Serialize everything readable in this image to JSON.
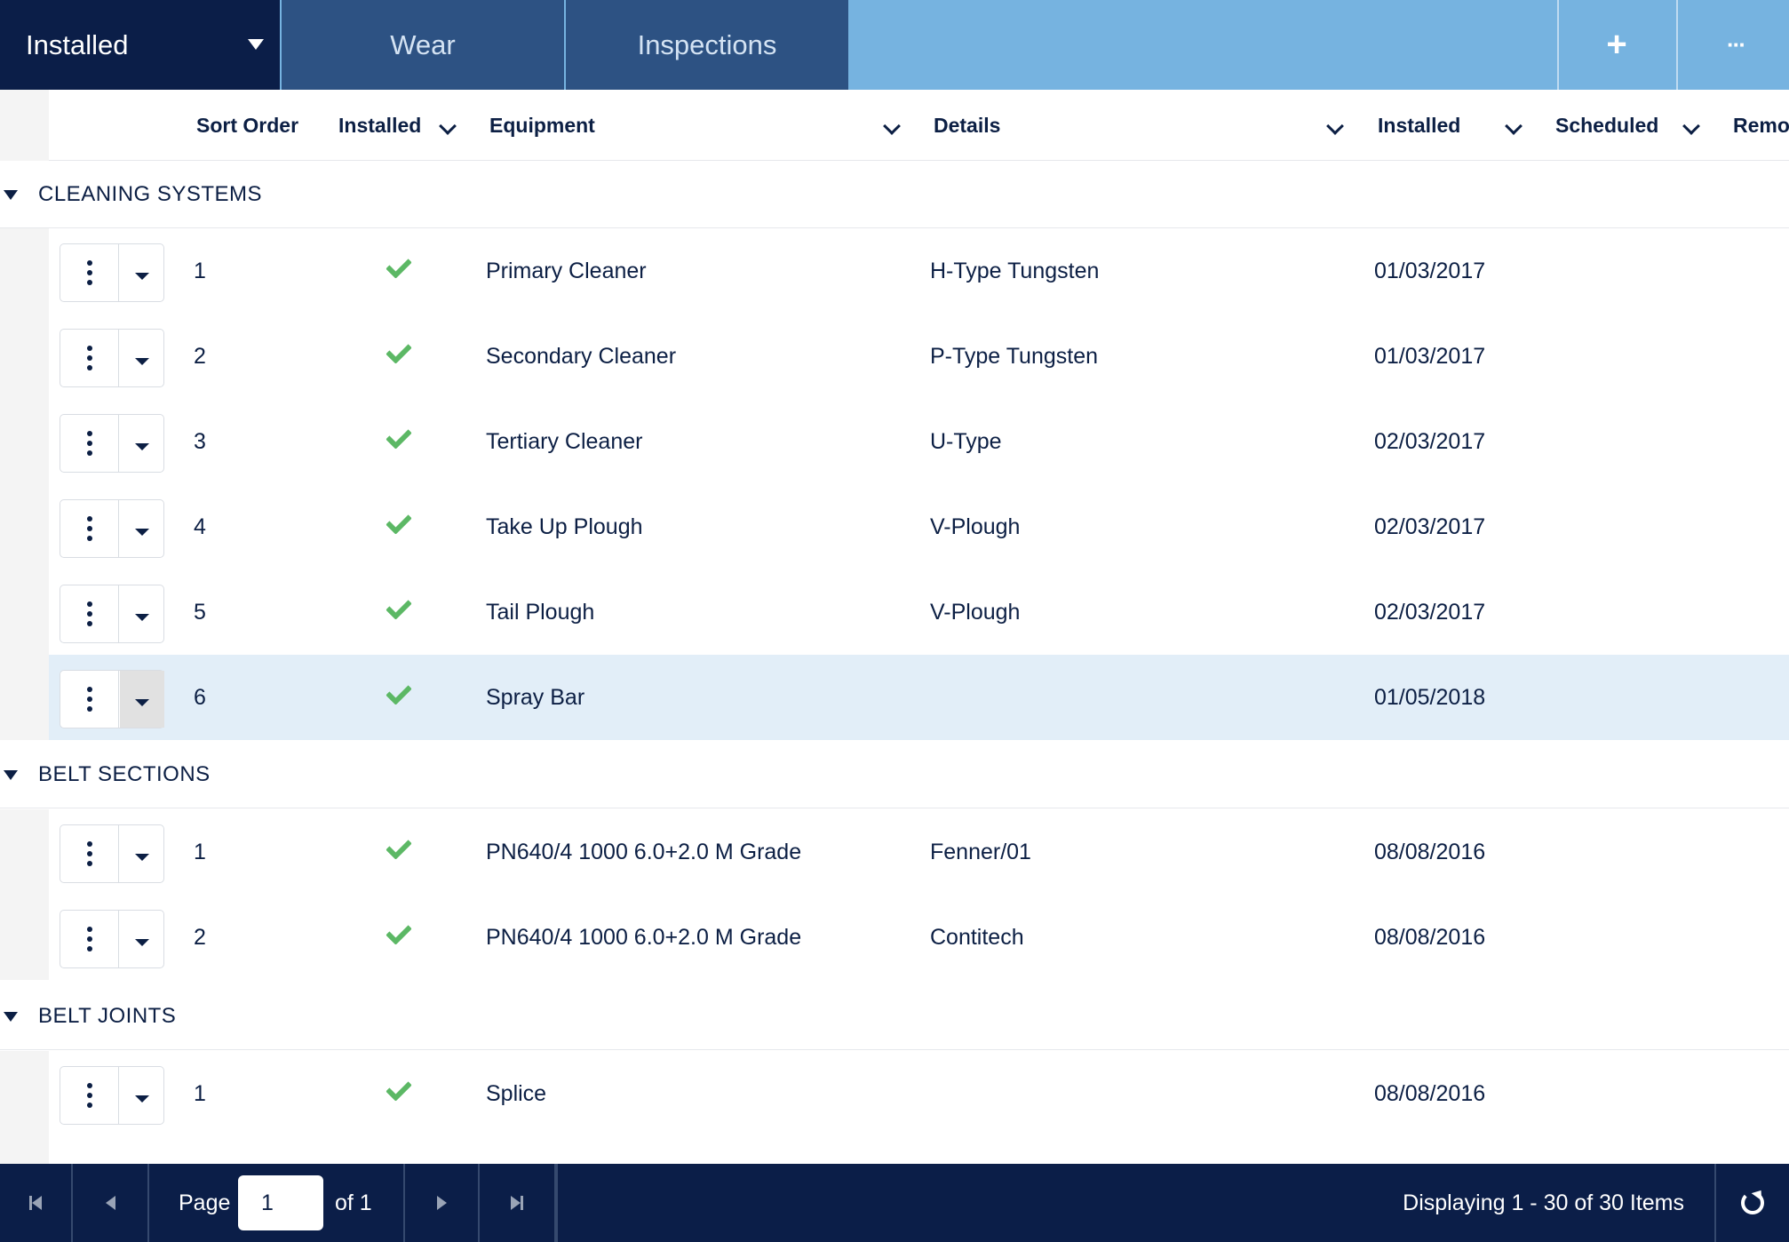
{
  "topbar": {
    "view_select": "Installed",
    "tabs": [
      "Wear",
      "Inspections"
    ],
    "add_glyph": "+",
    "more_glyph": "···"
  },
  "columns": {
    "sort_order": "Sort Order",
    "installed_flag": "Installed",
    "equipment": "Equipment",
    "details": "Details",
    "installed_date": "Installed",
    "scheduled": "Scheduled",
    "removed": "Remo"
  },
  "groups": [
    {
      "title": "CLEANING SYSTEMS",
      "rows": [
        {
          "order": "1",
          "equipment": "Primary Cleaner",
          "details": "H-Type Tungsten",
          "installed": "01/03/2017"
        },
        {
          "order": "2",
          "equipment": "Secondary Cleaner",
          "details": "P-Type Tungsten",
          "installed": "01/03/2017"
        },
        {
          "order": "3",
          "equipment": "Tertiary Cleaner",
          "details": "U-Type",
          "installed": "02/03/2017"
        },
        {
          "order": "4",
          "equipment": "Take Up Plough",
          "details": "V-Plough",
          "installed": "02/03/2017"
        },
        {
          "order": "5",
          "equipment": "Tail Plough",
          "details": "V-Plough",
          "installed": "02/03/2017"
        },
        {
          "order": "6",
          "equipment": "Spray Bar",
          "details": "",
          "installed": "01/05/2018"
        }
      ]
    },
    {
      "title": "BELT SECTIONS",
      "rows": [
        {
          "order": "1",
          "equipment": "PN640/4 1000 6.0+2.0 M Grade",
          "details": "Fenner/01",
          "installed": "08/08/2016"
        },
        {
          "order": "2",
          "equipment": "PN640/4 1000 6.0+2.0 M Grade",
          "details": "Contitech",
          "installed": "08/08/2016"
        }
      ]
    },
    {
      "title": "BELT JOINTS",
      "rows": [
        {
          "order": "1",
          "equipment": "Splice",
          "details": "",
          "installed": "08/08/2016"
        }
      ]
    }
  ],
  "footer": {
    "page_label": "Page",
    "page_value": "1",
    "of_label": "of 1",
    "display_text": "Displaying 1 - 30 of 30 Items"
  },
  "colors": {
    "nav_dark": "#0b1e48",
    "tab_mid": "#2d5283",
    "topbar_light": "#76b3e0",
    "check_green": "#5cb865",
    "selected_row": "#e2eef8"
  }
}
